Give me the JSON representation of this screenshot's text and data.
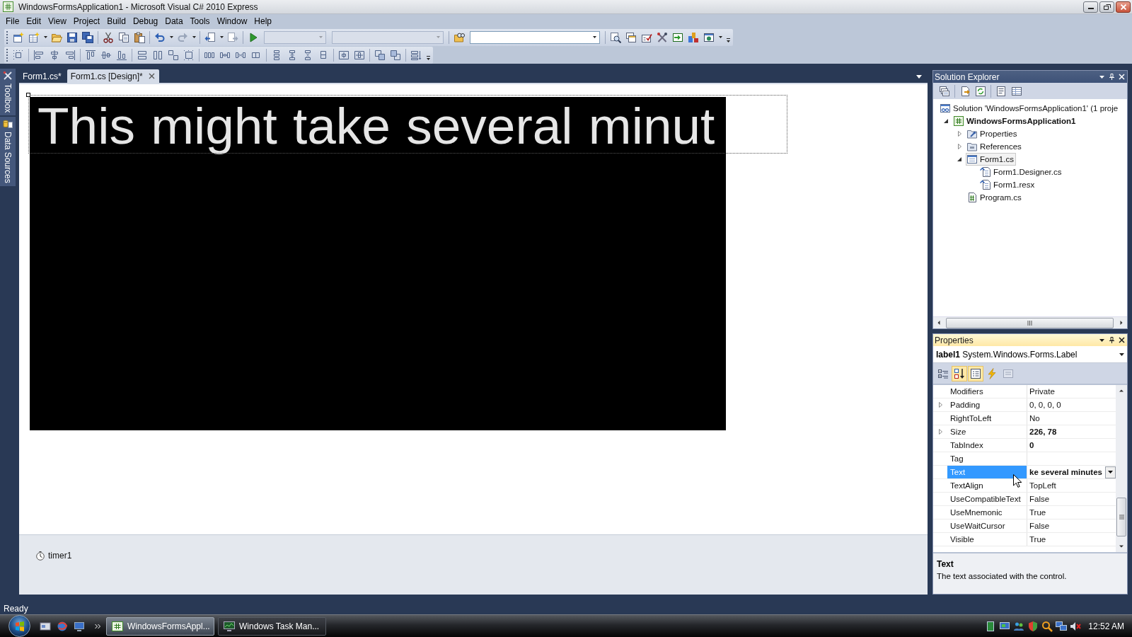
{
  "window": {
    "title": "WindowsFormsApplication1 - Microsoft Visual C# 2010 Express"
  },
  "menu": [
    "File",
    "Edit",
    "View",
    "Project",
    "Build",
    "Debug",
    "Data",
    "Tools",
    "Window",
    "Help"
  ],
  "toolbar": {
    "comboboxes": [
      {
        "disabled": true
      },
      {
        "disabled": true
      },
      {
        "disabled": false
      }
    ]
  },
  "side_tabs": [
    {
      "label": "Toolbox",
      "kind": "toolbox"
    },
    {
      "label": "Data Sources",
      "kind": "data"
    }
  ],
  "document_tabs": [
    {
      "label": "Form1.cs*",
      "selected": false
    },
    {
      "label": "Form1.cs [Design]*",
      "selected": true
    }
  ],
  "designer": {
    "label_text": "This might take several minut",
    "label_selected": true,
    "component_tray": [
      {
        "label": "timer1"
      }
    ]
  },
  "solution_explorer": {
    "title": "Solution Explorer",
    "active": false,
    "tree": [
      {
        "label": "Solution 'WindowsFormsApplication1' (1 proje",
        "kind": "solution",
        "selected": false,
        "children": [
          {
            "label": "WindowsFormsApplication1",
            "kind": "project",
            "expanded": true,
            "selected": false,
            "children": [
              {
                "label": "Properties",
                "kind": "properties",
                "expanded": false,
                "selected": false
              },
              {
                "label": "References",
                "kind": "references",
                "expanded": false,
                "selected": false
              },
              {
                "label": "Form1.cs",
                "kind": "form",
                "expanded": true,
                "selected": true,
                "children": [
                  {
                    "label": "Form1.Designer.cs",
                    "kind": "dependent",
                    "selected": false
                  },
                  {
                    "label": "Form1.resx",
                    "kind": "dependent",
                    "selected": false
                  }
                ]
              },
              {
                "label": "Program.cs",
                "kind": "code",
                "selected": false
              }
            ]
          }
        ]
      }
    ]
  },
  "properties": {
    "title": "Properties",
    "active": true,
    "object_name": "label1",
    "object_type": "System.Windows.Forms.Label",
    "toolbar": [
      {
        "kind": "categorized",
        "selected": false,
        "disabled": false
      },
      {
        "kind": "alphabetical",
        "selected": true,
        "disabled": false
      },
      {
        "kind": "properties",
        "selected": true,
        "disabled": false
      },
      {
        "kind": "events",
        "selected": false,
        "disabled": false
      },
      {
        "kind": "pages",
        "selected": false,
        "disabled": true
      }
    ],
    "rows": [
      {
        "name": "Modifiers",
        "value": "Private",
        "expandable": false,
        "modified": false,
        "selected": false
      },
      {
        "name": "Padding",
        "value": "0, 0, 0, 0",
        "expandable": true,
        "modified": false,
        "selected": false
      },
      {
        "name": "RightToLeft",
        "value": "No",
        "expandable": false,
        "modified": false,
        "selected": false
      },
      {
        "name": "Size",
        "value": "226, 78",
        "expandable": true,
        "modified": true,
        "selected": false
      },
      {
        "name": "TabIndex",
        "value": "0",
        "expandable": false,
        "modified": true,
        "selected": false
      },
      {
        "name": "Tag",
        "expandable": false,
        "selected": false
      },
      {
        "name": "Text",
        "value": "ke several minutes",
        "expandable": false,
        "modified": true,
        "selected": true
      },
      {
        "name": "TextAlign",
        "value": "TopLeft",
        "expandable": false,
        "modified": false,
        "selected": false
      },
      {
        "name": "UseCompatibleText",
        "value": "False",
        "expandable": false,
        "modified": false,
        "selected": false
      },
      {
        "name": "UseMnemonic",
        "value": "True",
        "expandable": false,
        "modified": false,
        "selected": false
      },
      {
        "name": "UseWaitCursor",
        "value": "False",
        "expandable": false,
        "modified": false,
        "selected": false
      },
      {
        "name": "Visible",
        "value": "True",
        "expandable": false,
        "modified": false,
        "selected": false
      }
    ],
    "description": {
      "title": "Text",
      "text": "The text associated with the control."
    }
  },
  "status_bar": {
    "text": "Ready"
  },
  "taskbar": {
    "tasks": [
      {
        "label": "WindowsFormsAppl...",
        "kind": "ide",
        "selected": true
      },
      {
        "label": "Windows Task Man...",
        "kind": "monitor",
        "selected": false
      }
    ],
    "clock": "12:52 AM"
  }
}
